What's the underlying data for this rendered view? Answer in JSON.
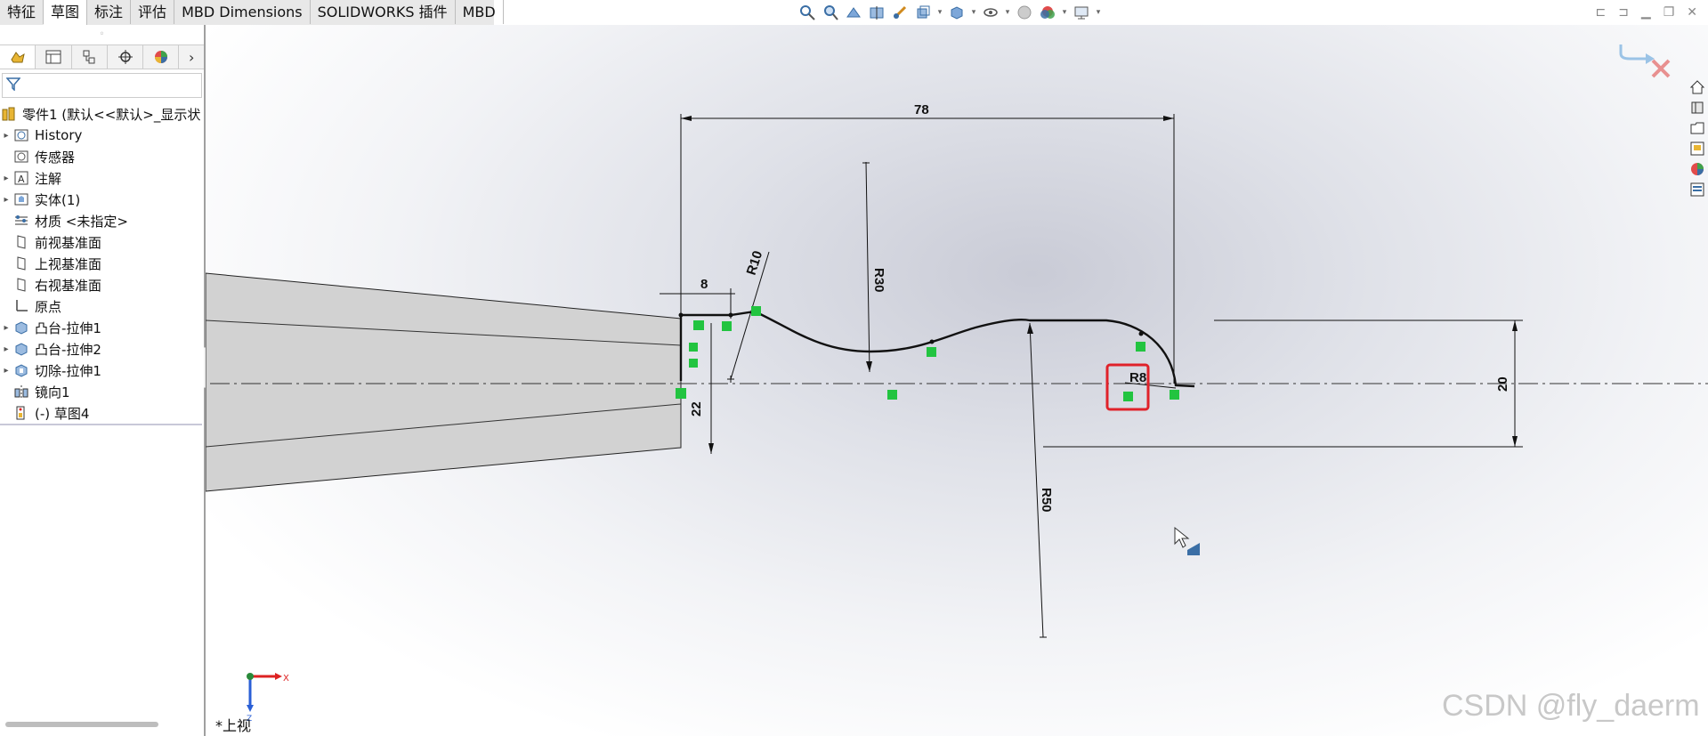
{
  "tabs": [
    {
      "label": "特征"
    },
    {
      "label": "草图"
    },
    {
      "label": "标注"
    },
    {
      "label": "评估"
    },
    {
      "label": "MBD Dimensions"
    },
    {
      "label": "SOLIDWORKS 插件"
    },
    {
      "label": "MBD"
    }
  ],
  "active_tab": "草图",
  "feature_tree": {
    "root": "零件1  (默认<<默认>_显示状",
    "items": [
      {
        "label": "History",
        "icon": "history-icon",
        "expandable": true
      },
      {
        "label": "传感器",
        "icon": "sensor-icon",
        "expandable": false
      },
      {
        "label": "注解",
        "icon": "annotation-icon",
        "expandable": true
      },
      {
        "label": "实体(1)",
        "icon": "solid-body-icon",
        "expandable": true
      },
      {
        "label": "材质 <未指定>",
        "icon": "material-icon",
        "expandable": false
      },
      {
        "label": "前视基准面",
        "icon": "plane-icon",
        "expandable": false
      },
      {
        "label": "上视基准面",
        "icon": "plane-icon",
        "expandable": false
      },
      {
        "label": "右视基准面",
        "icon": "plane-icon",
        "expandable": false
      },
      {
        "label": "原点",
        "icon": "origin-icon",
        "expandable": false
      },
      {
        "label": "凸台-拉伸1",
        "icon": "boss-extrude-icon",
        "expandable": true
      },
      {
        "label": "凸台-拉伸2",
        "icon": "boss-extrude-icon",
        "expandable": true
      },
      {
        "label": "切除-拉伸1",
        "icon": "cut-extrude-icon",
        "expandable": true
      },
      {
        "label": "镜向1",
        "icon": "mirror-icon",
        "expandable": false
      },
      {
        "label": "(-) 草图4",
        "icon": "sketch-icon",
        "expandable": false
      }
    ]
  },
  "dimensions": {
    "d78": "78",
    "d8": "8",
    "r10": "R10",
    "r30": "R30",
    "d22": "22",
    "r50": "R50",
    "r8": "R8",
    "d20": "20"
  },
  "view_label": "*上视",
  "triad": {
    "x": "X",
    "z": "Z"
  },
  "watermark": "CSDN @fly_daerm",
  "colors": {
    "relation_green": "#22c440",
    "highlight_red": "#e0222a",
    "sketch_black": "#111111"
  }
}
